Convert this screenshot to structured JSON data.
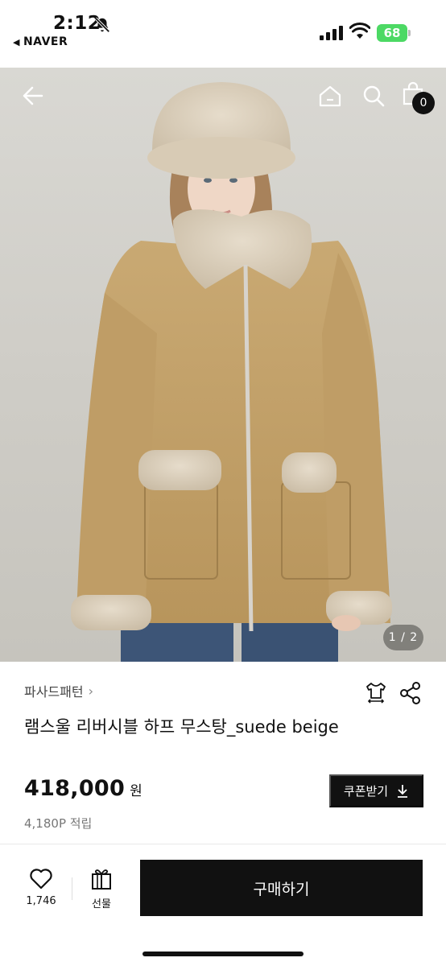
{
  "status_bar": {
    "time": "2:12",
    "back_app": "NAVER",
    "battery": "68"
  },
  "header": {
    "cart_count": "0"
  },
  "gallery": {
    "indicator": "1 / 2"
  },
  "product": {
    "brand": "파사드패턴",
    "title": "램스울 리버시블 하프 무스탕_suede beige",
    "price": "418,000",
    "currency": "원",
    "points": "4,180P 적립",
    "coupon_label": "쿠폰받기"
  },
  "bottom_bar": {
    "like_count": "1,746",
    "gift_label": "선물",
    "buy_label": "구매하기"
  },
  "icons": [
    "bell-slash-icon",
    "signal-icon",
    "wifi-icon",
    "battery-icon",
    "back-arrow-icon",
    "home-icon",
    "search-icon",
    "shopping-bag-icon",
    "size-guide-icon",
    "share-icon",
    "download-icon",
    "heart-icon",
    "gift-icon"
  ],
  "colors": {
    "primary": "#111111",
    "battery": "#4cd964"
  }
}
